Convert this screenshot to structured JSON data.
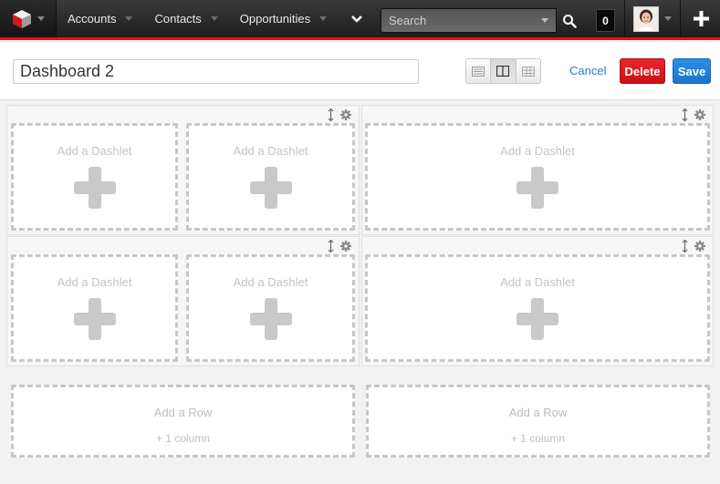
{
  "nav": {
    "items": [
      {
        "label": "Accounts"
      },
      {
        "label": "Contacts"
      },
      {
        "label": "Opportunities"
      }
    ],
    "search_placeholder": "Search",
    "notification_count": "0"
  },
  "header": {
    "title": "Dashboard 2",
    "cancel_label": "Cancel",
    "delete_label": "Delete",
    "save_label": "Save"
  },
  "dashlet": {
    "add_label": "Add a Dashlet"
  },
  "row_add": {
    "label": "Add a Row",
    "sub_label": "+ 1 column"
  },
  "colors": {
    "accent_red": "#d8161b",
    "save_blue": "#1f7dd7",
    "delete_red": "#dc1a1f"
  }
}
